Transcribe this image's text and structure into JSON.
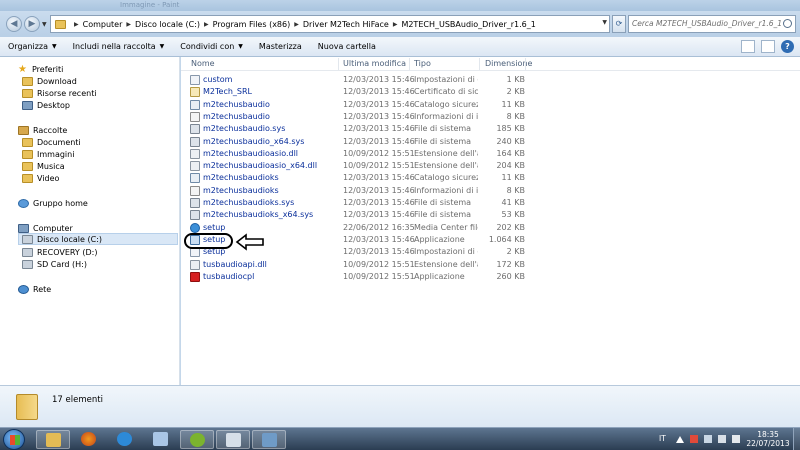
{
  "window": {
    "title": "Immagine - Paint"
  },
  "address": {
    "crumbs": [
      "Computer",
      "Disco locale (C:)",
      "Program Files (x86)",
      "Driver M2Tech HiFace",
      "M2TECH_USBAudio_Driver_r1.6_1"
    ]
  },
  "search": {
    "placeholder": "Cerca M2TECH_USBAudio_Driver_r1.6_1"
  },
  "toolbar": {
    "organize": "Organizza",
    "include": "Includi nella raccolta",
    "share": "Condividi con",
    "burn": "Masterizza",
    "new_folder": "Nuova cartella"
  },
  "nav": {
    "favorites": "Preferiti",
    "download": "Download",
    "recent": "Risorse recenti",
    "desktop": "Desktop",
    "libraries": "Raccolte",
    "documents": "Documenti",
    "pictures": "Immagini",
    "music": "Musica",
    "video": "Video",
    "homegroup": "Gruppo home",
    "computer": "Computer",
    "drive_c": "Disco locale (C:)",
    "drive_d": "RECOVERY (D:)",
    "drive_h": "SD Card (H:)",
    "network": "Rete"
  },
  "columns": {
    "name": "Nome",
    "date": "Ultima modifica",
    "type": "Tipo",
    "size": "Dimensione"
  },
  "files": [
    {
      "name": "custom",
      "date": "12/03/2013 15:46",
      "type": "Impostazioni di co...",
      "size": "1 KB",
      "icon": "fi-ini"
    },
    {
      "name": "M2Tech_SRL",
      "date": "12/03/2013 15:46",
      "type": "Certificato di sicu...",
      "size": "2 KB",
      "icon": "fi-cert"
    },
    {
      "name": "m2techusbaudio",
      "date": "12/03/2013 15:46",
      "type": "Catalogo sicurezza",
      "size": "11 KB",
      "icon": "fi-cat"
    },
    {
      "name": "m2techusbaudio",
      "date": "12/03/2013 15:46",
      "type": "Informazioni di in...",
      "size": "8 KB",
      "icon": "fi-inf"
    },
    {
      "name": "m2techusbaudio.sys",
      "date": "12/03/2013 15:46",
      "type": "File di sistema",
      "size": "185 KB",
      "icon": "fi-sys"
    },
    {
      "name": "m2techusbaudio_x64.sys",
      "date": "12/03/2013 15:46",
      "type": "File di sistema",
      "size": "240 KB",
      "icon": "fi-sys"
    },
    {
      "name": "m2techusbaudioasio.dll",
      "date": "10/09/2012 15:51",
      "type": "Estensione dell'ap...",
      "size": "164 KB",
      "icon": "fi-dll"
    },
    {
      "name": "m2techusbaudioasio_x64.dll",
      "date": "10/09/2012 15:51",
      "type": "Estensione dell'ap...",
      "size": "204 KB",
      "icon": "fi-dll"
    },
    {
      "name": "m2techusbaudioks",
      "date": "12/03/2013 15:46",
      "type": "Catalogo sicurezza",
      "size": "11 KB",
      "icon": "fi-cat"
    },
    {
      "name": "m2techusbaudioks",
      "date": "12/03/2013 15:46",
      "type": "Informazioni di in...",
      "size": "8 KB",
      "icon": "fi-inf"
    },
    {
      "name": "m2techusbaudioks.sys",
      "date": "12/03/2013 15:46",
      "type": "File di sistema",
      "size": "41 KB",
      "icon": "fi-sys"
    },
    {
      "name": "m2techusbaudioks_x64.sys",
      "date": "12/03/2013 15:46",
      "type": "File di sistema",
      "size": "53 KB",
      "icon": "fi-sys"
    },
    {
      "name": "setup",
      "date": "22/06/2012 16:35",
      "type": "Media Center file",
      "size": "202 KB",
      "icon": "fi-mce"
    },
    {
      "name": "setup",
      "date": "12/03/2013 15:46",
      "type": "Applicazione",
      "size": "1.064 KB",
      "icon": "fi-app"
    },
    {
      "name": "setup",
      "date": "12/03/2013 15:46",
      "type": "Impostazioni di co...",
      "size": "2 KB",
      "icon": "fi-ini"
    },
    {
      "name": "tusbaudioapi.dll",
      "date": "10/09/2012 15:51",
      "type": "Estensione dell'ap...",
      "size": "172 KB",
      "icon": "fi-dll"
    },
    {
      "name": "tusbaudiocpl",
      "date": "10/09/2012 15:51",
      "type": "Applicazione",
      "size": "260 KB",
      "icon": "fi-tusb"
    }
  ],
  "status": {
    "count": "17 elementi"
  },
  "taskbar": {
    "lang": "IT",
    "time": "18:35",
    "date": "22/07/2013"
  }
}
